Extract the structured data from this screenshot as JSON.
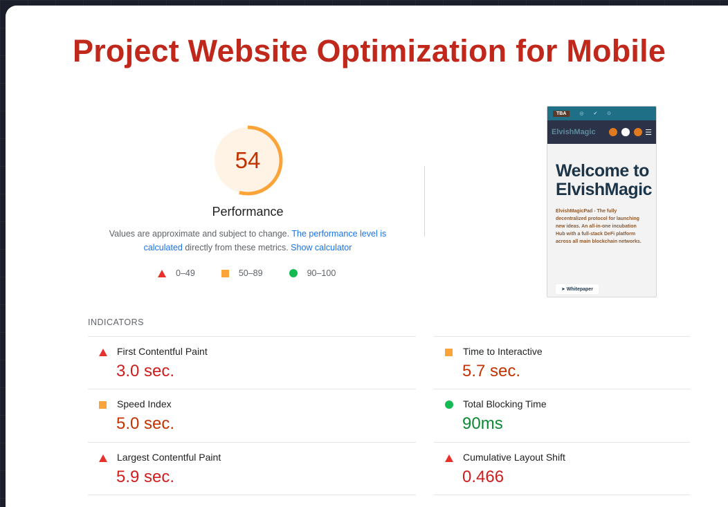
{
  "slide": {
    "title": "Project Website Optimization for Mobile"
  },
  "performance": {
    "score": "54",
    "score_fraction": 0.54,
    "label": "Performance",
    "desc_part1": "Values are approximate and subject to change. ",
    "desc_link1": "The performance level is calculated",
    "desc_part2": " directly from these metrics. ",
    "desc_link2": "Show calculator",
    "gauge_color": "#fba43a",
    "gauge_bg": "#fff3e6"
  },
  "legend": {
    "fail": "0–49",
    "average": "50–89",
    "pass": "90–100",
    "colors": {
      "fail": "#e8312b",
      "average": "#fba43a",
      "pass": "#14b954"
    }
  },
  "screenshot": {
    "badge": "TBA",
    "social": "◎ ✔ ⊙",
    "logo": "ElvishMagic",
    "hero": "Welcome to ElvishMagic",
    "paragraph": "ElvishMagicPad - The fully decentralized protocol for launching new ideas. An all-in-one incubation Hub with a full-stack DeFi platform across all main blockchain networks.",
    "button": "➤ Whitepaper"
  },
  "indicators": {
    "heading": "INDICATORS",
    "items": [
      {
        "name": "First Contentful Paint",
        "value": "3.0 sec.",
        "status": "fail"
      },
      {
        "name": "Time to Interactive",
        "value": "5.7 sec.",
        "status": "average"
      },
      {
        "name": "Speed Index",
        "value": "5.0 sec.",
        "status": "average"
      },
      {
        "name": "Total Blocking Time",
        "value": "90ms",
        "status": "pass"
      },
      {
        "name": "Largest Contentful Paint",
        "value": "5.9 sec.",
        "status": "fail"
      },
      {
        "name": "Cumulative Layout Shift",
        "value": "0.466",
        "status": "fail"
      }
    ]
  }
}
